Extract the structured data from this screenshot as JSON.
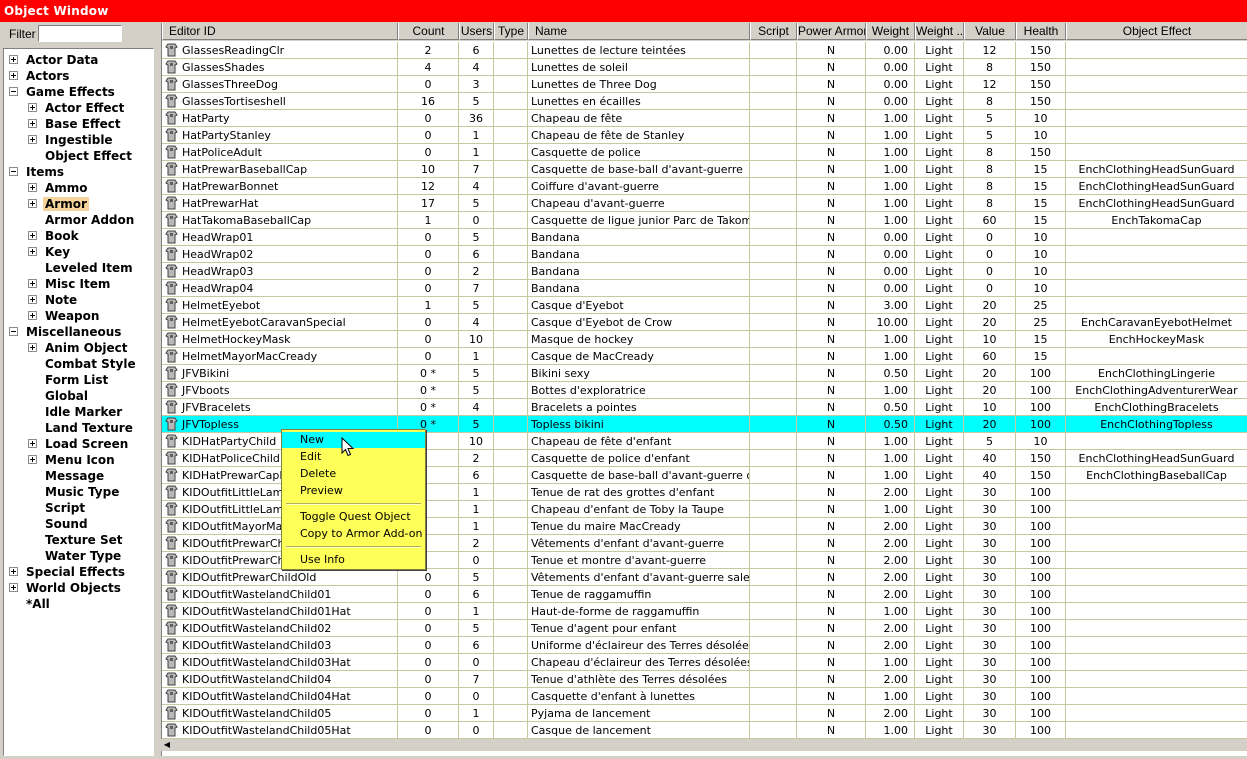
{
  "window": {
    "title": "Object Window"
  },
  "filter": {
    "label": "Filter",
    "value": ""
  },
  "tree": [
    {
      "label": "Actor Data",
      "level": 0,
      "exp": "plus"
    },
    {
      "label": "Actors",
      "level": 0,
      "exp": "plus"
    },
    {
      "label": "Game Effects",
      "level": 0,
      "exp": "minus"
    },
    {
      "label": "Actor Effect",
      "level": 1,
      "exp": "plus"
    },
    {
      "label": "Base Effect",
      "level": 1,
      "exp": "plus"
    },
    {
      "label": "Ingestible",
      "level": 1,
      "exp": "plus"
    },
    {
      "label": "Object Effect",
      "level": 1,
      "exp": ""
    },
    {
      "label": "Items",
      "level": 0,
      "exp": "minus"
    },
    {
      "label": "Ammo",
      "level": 1,
      "exp": "plus"
    },
    {
      "label": "Armor",
      "level": 1,
      "exp": "plus",
      "selected": true
    },
    {
      "label": "Armor Addon",
      "level": 1,
      "exp": ""
    },
    {
      "label": "Book",
      "level": 1,
      "exp": "plus"
    },
    {
      "label": "Key",
      "level": 1,
      "exp": "plus"
    },
    {
      "label": "Leveled Item",
      "level": 1,
      "exp": ""
    },
    {
      "label": "Misc Item",
      "level": 1,
      "exp": "plus"
    },
    {
      "label": "Note",
      "level": 1,
      "exp": "plus"
    },
    {
      "label": "Weapon",
      "level": 1,
      "exp": "plus"
    },
    {
      "label": "Miscellaneous",
      "level": 0,
      "exp": "minus"
    },
    {
      "label": "Anim Object",
      "level": 1,
      "exp": "plus"
    },
    {
      "label": "Combat Style",
      "level": 1,
      "exp": ""
    },
    {
      "label": "Form List",
      "level": 1,
      "exp": ""
    },
    {
      "label": "Global",
      "level": 1,
      "exp": ""
    },
    {
      "label": "Idle Marker",
      "level": 1,
      "exp": ""
    },
    {
      "label": "Land Texture",
      "level": 1,
      "exp": ""
    },
    {
      "label": "Load Screen",
      "level": 1,
      "exp": "plus"
    },
    {
      "label": "Menu Icon",
      "level": 1,
      "exp": "plus"
    },
    {
      "label": "Message",
      "level": 1,
      "exp": ""
    },
    {
      "label": "Music Type",
      "level": 1,
      "exp": ""
    },
    {
      "label": "Script",
      "level": 1,
      "exp": ""
    },
    {
      "label": "Sound",
      "level": 1,
      "exp": ""
    },
    {
      "label": "Texture Set",
      "level": 1,
      "exp": ""
    },
    {
      "label": "Water Type",
      "level": 1,
      "exp": ""
    },
    {
      "label": "Special Effects",
      "level": 0,
      "exp": "plus"
    },
    {
      "label": "World Objects",
      "level": 0,
      "exp": "plus"
    },
    {
      "label": "*All",
      "level": 0,
      "exp": ""
    }
  ],
  "columns": [
    "Editor ID",
    "Count",
    "Users",
    "Type",
    "Name",
    "Script",
    "Power Armor",
    "Weight",
    "Weight ...",
    "Value",
    "Health",
    "Object Effect"
  ],
  "rows": [
    [
      "GlassesReadingClr",
      "2",
      "6",
      "",
      "Lunettes de lecture teintées",
      "",
      "N",
      "0.00",
      "Light",
      "12",
      "150",
      ""
    ],
    [
      "GlassesShades",
      "4",
      "4",
      "",
      "Lunettes de soleil",
      "",
      "N",
      "0.00",
      "Light",
      "8",
      "150",
      ""
    ],
    [
      "GlassesThreeDog",
      "0",
      "3",
      "",
      "Lunettes de Three Dog",
      "",
      "N",
      "0.00",
      "Light",
      "12",
      "150",
      ""
    ],
    [
      "GlassesTortiseshell",
      "16",
      "5",
      "",
      "Lunettes en écailles",
      "",
      "N",
      "0.00",
      "Light",
      "8",
      "150",
      ""
    ],
    [
      "HatParty",
      "0",
      "36",
      "",
      "Chapeau de fête",
      "",
      "N",
      "1.00",
      "Light",
      "5",
      "10",
      ""
    ],
    [
      "HatPartyStanley",
      "0",
      "1",
      "",
      "Chapeau de fête de Stanley",
      "",
      "N",
      "1.00",
      "Light",
      "5",
      "10",
      ""
    ],
    [
      "HatPoliceAdult",
      "0",
      "1",
      "",
      "Casquette de police",
      "",
      "N",
      "1.00",
      "Light",
      "8",
      "150",
      ""
    ],
    [
      "HatPrewarBaseballCap",
      "10",
      "7",
      "",
      "Casquette de base-ball d'avant-guerre",
      "",
      "N",
      "1.00",
      "Light",
      "8",
      "15",
      "EnchClothingHeadSunGuard"
    ],
    [
      "HatPrewarBonnet",
      "12",
      "4",
      "",
      "Coiffure d'avant-guerre",
      "",
      "N",
      "1.00",
      "Light",
      "8",
      "15",
      "EnchClothingHeadSunGuard"
    ],
    [
      "HatPrewarHat",
      "17",
      "5",
      "",
      "Chapeau d'avant-guerre",
      "",
      "N",
      "1.00",
      "Light",
      "8",
      "15",
      "EnchClothingHeadSunGuard"
    ],
    [
      "HatTakomaBaseballCap",
      "1",
      "0",
      "",
      "Casquette de ligue junior Parc de Takoma",
      "",
      "N",
      "1.00",
      "Light",
      "60",
      "15",
      "EnchTakomaCap"
    ],
    [
      "HeadWrap01",
      "0",
      "5",
      "",
      "Bandana",
      "",
      "N",
      "0.00",
      "Light",
      "0",
      "10",
      ""
    ],
    [
      "HeadWrap02",
      "0",
      "6",
      "",
      "Bandana",
      "",
      "N",
      "0.00",
      "Light",
      "0",
      "10",
      ""
    ],
    [
      "HeadWrap03",
      "0",
      "2",
      "",
      "Bandana",
      "",
      "N",
      "0.00",
      "Light",
      "0",
      "10",
      ""
    ],
    [
      "HeadWrap04",
      "0",
      "7",
      "",
      "Bandana",
      "",
      "N",
      "0.00",
      "Light",
      "0",
      "10",
      ""
    ],
    [
      "HelmetEyebot",
      "1",
      "5",
      "",
      "Casque d'Eyebot",
      "",
      "N",
      "3.00",
      "Light",
      "20",
      "25",
      ""
    ],
    [
      "HelmetEyebotCaravanSpecial",
      "0",
      "4",
      "",
      "Casque d'Eyebot de Crow",
      "",
      "N",
      "10.00",
      "Light",
      "20",
      "25",
      "EnchCaravanEyebotHelmet"
    ],
    [
      "HelmetHockeyMask",
      "0",
      "10",
      "",
      "Masque de hockey",
      "",
      "N",
      "1.00",
      "Light",
      "10",
      "15",
      "EnchHockeyMask"
    ],
    [
      "HelmetMayorMacCready",
      "0",
      "1",
      "",
      "Casque de MacCready",
      "",
      "N",
      "1.00",
      "Light",
      "60",
      "15",
      ""
    ],
    [
      "JFVBikini",
      "0 *",
      "5",
      "",
      "Bikini sexy",
      "",
      "N",
      "0.50",
      "Light",
      "20",
      "100",
      "EnchClothingLingerie"
    ],
    [
      "JFVboots",
      "0 *",
      "5",
      "",
      "Bottes d'exploratrice",
      "",
      "N",
      "1.00",
      "Light",
      "20",
      "100",
      "EnchClothingAdventurerWear"
    ],
    [
      "JFVBracelets",
      "0 *",
      "4",
      "",
      "Bracelets a pointes",
      "",
      "N",
      "0.50",
      "Light",
      "10",
      "100",
      "EnchClothingBracelets"
    ],
    [
      "JFVTopless",
      "0 *",
      "5",
      "",
      "Topless bikini",
      "",
      "N",
      "0.50",
      "Light",
      "20",
      "100",
      "EnchClothingTopless"
    ],
    [
      "KIDHatPartyChild",
      "",
      "10",
      "",
      "Chapeau de fête d'enfant",
      "",
      "N",
      "1.00",
      "Light",
      "5",
      "10",
      ""
    ],
    [
      "KIDHatPoliceChild",
      "",
      "2",
      "",
      "Casquette de police d'enfant",
      "",
      "N",
      "1.00",
      "Light",
      "40",
      "150",
      "EnchClothingHeadSunGuard"
    ],
    [
      "KIDHatPrewarCapKi",
      "",
      "6",
      "",
      "Casquette de base-ball d'avant-guerre d'enfant",
      "",
      "N",
      "1.00",
      "Light",
      "40",
      "150",
      "EnchClothingBaseballCap"
    ],
    [
      "KIDOutfitLittleLampligh",
      "",
      "1",
      "",
      "Tenue de rat des grottes d'enfant",
      "",
      "N",
      "2.00",
      "Light",
      "30",
      "100",
      ""
    ],
    [
      "KIDOutfitLittleLampligh",
      "",
      "1",
      "",
      "Chapeau d'enfant de Toby la Taupe",
      "",
      "N",
      "1.00",
      "Light",
      "30",
      "100",
      ""
    ],
    [
      "KIDOutfitMayorMacC",
      "",
      "1",
      "",
      "Tenue du maire MacCready",
      "",
      "N",
      "2.00",
      "Light",
      "30",
      "100",
      ""
    ],
    [
      "KIDOutfitPrewarChild",
      "",
      "2",
      "",
      "Vêtements d'enfant d'avant-guerre",
      "",
      "N",
      "2.00",
      "Light",
      "30",
      "100",
      ""
    ],
    [
      "KIDOutfitPrewarChild",
      "",
      "0",
      "",
      "Tenue et montre d'avant-guerre",
      "",
      "N",
      "2.00",
      "Light",
      "30",
      "100",
      ""
    ],
    [
      "KIDOutfitPrewarChildOld",
      "0",
      "5",
      "",
      "Vêtements d'enfant d'avant-guerre sales",
      "",
      "N",
      "2.00",
      "Light",
      "30",
      "100",
      ""
    ],
    [
      "KIDOutfitWastelandChild01",
      "0",
      "6",
      "",
      "Tenue de raggamuffin",
      "",
      "N",
      "2.00",
      "Light",
      "30",
      "100",
      ""
    ],
    [
      "KIDOutfitWastelandChild01Hat",
      "0",
      "1",
      "",
      "Haut-de-forme de raggamuffin",
      "",
      "N",
      "1.00",
      "Light",
      "30",
      "100",
      ""
    ],
    [
      "KIDOutfitWastelandChild02",
      "0",
      "5",
      "",
      "Tenue d'agent pour enfant",
      "",
      "N",
      "2.00",
      "Light",
      "30",
      "100",
      ""
    ],
    [
      "KIDOutfitWastelandChild03",
      "0",
      "6",
      "",
      "Uniforme d'éclaireur des Terres désolées",
      "",
      "N",
      "2.00",
      "Light",
      "30",
      "100",
      ""
    ],
    [
      "KIDOutfitWastelandChild03Hat",
      "0",
      "0",
      "",
      "Chapeau d'éclaireur des Terres désolées",
      "",
      "N",
      "1.00",
      "Light",
      "30",
      "100",
      ""
    ],
    [
      "KIDOutfitWastelandChild04",
      "0",
      "7",
      "",
      "Tenue d'athlète des Terres désolées",
      "",
      "N",
      "2.00",
      "Light",
      "30",
      "100",
      ""
    ],
    [
      "KIDOutfitWastelandChild04Hat",
      "0",
      "0",
      "",
      "Casquette d'enfant à lunettes",
      "",
      "N",
      "1.00",
      "Light",
      "30",
      "100",
      ""
    ],
    [
      "KIDOutfitWastelandChild05",
      "0",
      "1",
      "",
      "Pyjama de lancement",
      "",
      "N",
      "2.00",
      "Light",
      "30",
      "100",
      ""
    ],
    [
      "KIDOutfitWastelandChild05Hat",
      "0",
      "0",
      "",
      "Casque de lancement",
      "",
      "N",
      "1.00",
      "Light",
      "30",
      "100",
      ""
    ]
  ],
  "selected_row": 22,
  "context_menu": {
    "items": [
      "New",
      "Edit",
      "Delete",
      "Preview",
      "Toggle Quest Object",
      "Copy to Armor Add-on",
      "Use Info"
    ],
    "highlighted": "New"
  },
  "colors": {
    "titlebar": "#ff0000",
    "selection": "#00ffff",
    "menu": "#ffff5a"
  }
}
